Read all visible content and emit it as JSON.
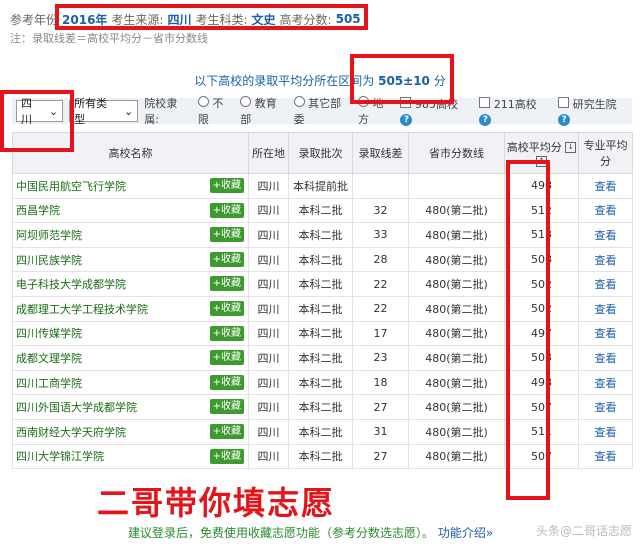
{
  "header": {
    "ref_year_label": "参考年份",
    "ref_year": "2016年",
    "source_label": "考生来源:",
    "source": "四川",
    "subject_label": "考生科类:",
    "subject": "文史",
    "score_label": "高考分数:",
    "score": "505"
  },
  "note": "注：录取线差＝高校平均分－省市分数线",
  "info": {
    "text": "以下高校的录取平均分所在区间为",
    "range": "505±10",
    "unit": "分"
  },
  "filters": {
    "province": "四川",
    "type": "所有类型",
    "affiliation_label": "院校隶属:",
    "radios": [
      "不限",
      "教育部",
      "其它部委",
      "地方"
    ],
    "checks": [
      "985高校",
      "211高校",
      "研究生院"
    ]
  },
  "table": {
    "headers": [
      "高校名称",
      "所在地",
      "录取批次",
      "录取线差",
      "省市分数线",
      "高校平均分",
      "专业平均分"
    ],
    "fav_label": "+收藏",
    "view_label": "查看",
    "rows": [
      {
        "name": "中国民用航空飞行学院",
        "loc": "四川",
        "batch": "本科提前批",
        "diff": "",
        "line": "",
        "avg": "498"
      },
      {
        "name": "西昌学院",
        "loc": "四川",
        "batch": "本科二批",
        "diff": "32",
        "line": "480(第二批)",
        "avg": "512"
      },
      {
        "name": "阿坝师范学院",
        "loc": "四川",
        "batch": "本科二批",
        "diff": "33",
        "line": "480(第二批)",
        "avg": "513"
      },
      {
        "name": "四川民族学院",
        "loc": "四川",
        "batch": "本科二批",
        "diff": "28",
        "line": "480(第二批)",
        "avg": "508"
      },
      {
        "name": "电子科技大学成都学院",
        "loc": "四川",
        "batch": "本科二批",
        "diff": "22",
        "line": "480(第二批)",
        "avg": "502"
      },
      {
        "name": "成都理工大学工程技术学院",
        "loc": "四川",
        "batch": "本科二批",
        "diff": "22",
        "line": "480(第二批)",
        "avg": "502"
      },
      {
        "name": "四川传媒学院",
        "loc": "四川",
        "batch": "本科二批",
        "diff": "17",
        "line": "480(第二批)",
        "avg": "497"
      },
      {
        "name": "成都文理学院",
        "loc": "四川",
        "batch": "本科二批",
        "diff": "23",
        "line": "480(第二批)",
        "avg": "503"
      },
      {
        "name": "四川工商学院",
        "loc": "四川",
        "batch": "本科二批",
        "diff": "18",
        "line": "480(第二批)",
        "avg": "498"
      },
      {
        "name": "四川外国语大学成都学院",
        "loc": "四川",
        "batch": "本科二批",
        "diff": "27",
        "line": "480(第二批)",
        "avg": "507"
      },
      {
        "name": "西南财经大学天府学院",
        "loc": "四川",
        "batch": "本科二批",
        "diff": "31",
        "line": "480(第二批)",
        "avg": "511"
      },
      {
        "name": "四川大学锦江学院",
        "loc": "四川",
        "batch": "本科二批",
        "diff": "27",
        "line": "480(第二批)",
        "avg": "507"
      }
    ]
  },
  "overlay_text": "二哥带你填志愿",
  "footer": {
    "text": "建议登录后，免费使用收藏志愿功能（参考分数选志愿）。",
    "link": "功能介绍»"
  },
  "watermark": "头条@二哥话志愿"
}
